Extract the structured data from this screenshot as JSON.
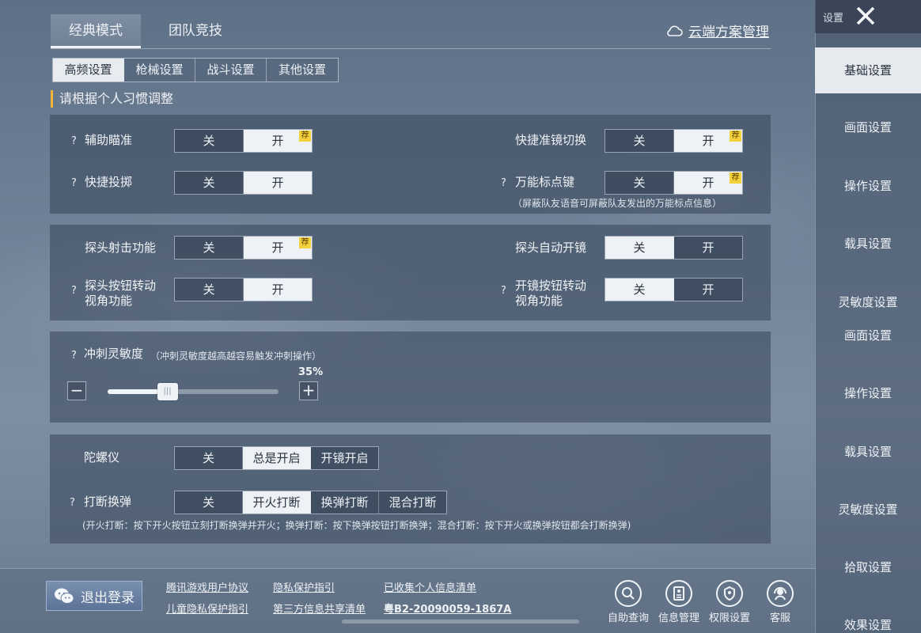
{
  "mode_tabs": [
    {
      "label": "经典模式",
      "active": true
    },
    {
      "label": "团队竞技",
      "active": false
    }
  ],
  "cloud_link": "云端方案管理",
  "sub_tabs": [
    {
      "label": "高频设置",
      "active": true
    },
    {
      "label": "枪械设置",
      "active": false
    },
    {
      "label": "战斗设置",
      "active": false
    },
    {
      "label": "其他设置",
      "active": false
    }
  ],
  "section_hint": "请根据个人习惯调整",
  "rec_badge": "荐",
  "help_mark": "?",
  "settings": {
    "aim_assist": {
      "label": "辅助瞄准",
      "off": "关",
      "on": "开"
    },
    "quick_scope": {
      "label": "快捷准镜切换",
      "off": "关",
      "on": "开"
    },
    "quick_throw": {
      "label": "快捷投掷",
      "off": "关",
      "on": "开"
    },
    "universal_mark": {
      "label": "万能标点键",
      "off": "关",
      "on": "开",
      "note": "（屏蔽队友语音可屏蔽队友发出的万能标点信息）"
    },
    "peek_fire": {
      "label": "探头射击功能",
      "off": "关",
      "on": "开"
    },
    "peek_auto_scope": {
      "label": "探头自动开镜",
      "off": "关",
      "on": "开"
    },
    "peek_rotate": {
      "label1": "探头按钮转动",
      "label2": "视角功能",
      "off": "关",
      "on": "开"
    },
    "scope_rotate": {
      "label1": "开镜按钮转动",
      "label2": "视角功能",
      "off": "关",
      "on": "开"
    },
    "sprint": {
      "label": "冲刺灵敏度",
      "note": "（冲刺灵敏度越高越容易触发冲刺操作）",
      "value_text": "35%",
      "value": 35,
      "minus": "−",
      "plus": "+"
    },
    "gyro": {
      "label": "陀螺仪",
      "options": [
        "关",
        "总是开启",
        "开镜开启"
      ],
      "selected": 1
    },
    "interrupt_reload": {
      "label": "打断换弹",
      "options": [
        "关",
        "开火打断",
        "换弹打断",
        "混合打断"
      ],
      "selected": 1,
      "note": "(开火打断：按下开火按钮立刻打断换弹并开火；换弹打断：按下换弹按钮打断换弹；混合打断：按下开火或换弹按钮都会打断换弹)"
    }
  },
  "footer": {
    "logout": "退出登录",
    "links": [
      "腾讯游戏用户协议",
      "隐私保护指引",
      "已收集个人信息清单",
      "儿童隐私保护指引",
      "第三方信息共享清单",
      "粤B2-20090059-1867A"
    ],
    "icons": [
      {
        "label": "自助查询",
        "icon": "search-icon"
      },
      {
        "label": "信息管理",
        "icon": "document-icon"
      },
      {
        "label": "权限设置",
        "icon": "shield-icon"
      },
      {
        "label": "客服",
        "icon": "headset-icon"
      }
    ]
  },
  "sidebar": {
    "title": "设置",
    "items": [
      "基础设置",
      "画面设置",
      "操作设置",
      "载具设置",
      "灵敏度设置",
      "画面设置",
      "操作设置",
      "载具设置",
      "灵敏度设置",
      "拾取设置",
      "效果设置"
    ],
    "active_index": 0
  }
}
